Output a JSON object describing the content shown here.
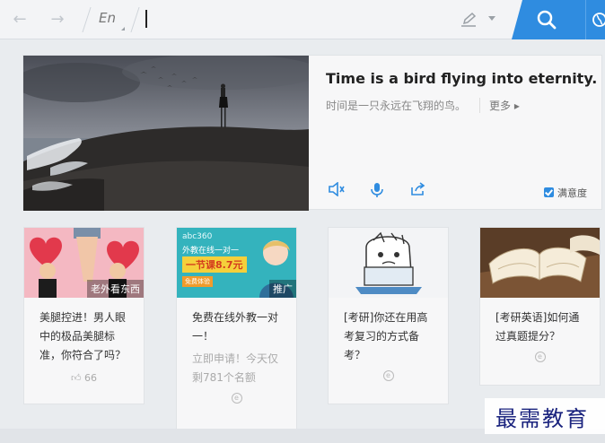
{
  "toolbar": {
    "back_icon": "arrow-left-icon",
    "forward_icon": "arrow-right-icon",
    "language": "En",
    "search_value": "",
    "colors": {
      "accent": "#2f8ce0",
      "bar_bg": "#f3f4f6"
    }
  },
  "hero": {
    "quote": "Time is a bird flying into eternity.",
    "translation": "时间是一只永远在飞翔的鸟。",
    "more": "更多 ▸",
    "satisfaction": "满意度"
  },
  "cards": [
    {
      "badge": "老外看东西",
      "title": "美腿控进！男人眼中的极品美腿标准，你符合了吗？",
      "likes": "66"
    },
    {
      "banner_top": "abc360",
      "banner_line": "外教在线一对一",
      "banner_price": "一节课8.7元",
      "banner_button": "免费体验",
      "badge": "推广",
      "title": "免费在线外教一对一！",
      "sub": "立即申请！今天仅剩781个名额"
    },
    {
      "title": "[考研]你还在用高考复习的方式备考？"
    },
    {
      "title": "[考研英语]如何通过真题提分？"
    }
  ],
  "watermark": "最需教育"
}
